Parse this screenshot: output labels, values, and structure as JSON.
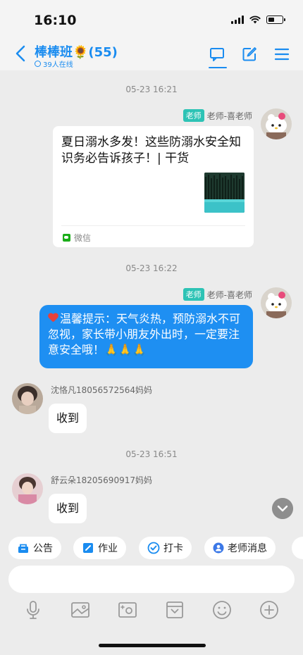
{
  "status_bar": {
    "time": "16:10"
  },
  "header": {
    "title": "棒棒班🌻(55)",
    "online_text": "39人在线"
  },
  "messages": [
    {
      "timestamp": "05-23 16:21"
    },
    {
      "role_badge": "老师",
      "sender": "老师-喜老师",
      "card": {
        "title": "夏日溺水多发！这些防溺水安全知识务必告诉孩子！| 干货",
        "source": "微信"
      }
    },
    {
      "timestamp": "05-23 16:22"
    },
    {
      "role_badge": "老师",
      "sender": "老师-喜老师",
      "text": "温馨提示：天气炎热，预防溺水不可忽视，家长带小朋友外出时，一定要注意安全哦！🙏🙏🙏"
    },
    {
      "sender": "沈恪凡18056572564妈妈",
      "text": "收到"
    },
    {
      "timestamp": "05-23 16:51"
    },
    {
      "sender": "舒云朵18205690917妈妈",
      "text": "收到"
    }
  ],
  "quick_actions": [
    {
      "label": "公告",
      "icon": "notice-icon"
    },
    {
      "label": "作业",
      "icon": "homework-icon"
    },
    {
      "label": "打卡",
      "icon": "checkin-icon"
    },
    {
      "label": "老师消息",
      "icon": "teacher-message-icon"
    }
  ],
  "input": {
    "placeholder": ""
  },
  "toolbar_icons": [
    "microphone-icon",
    "image-icon",
    "video-icon",
    "file-icon",
    "emoji-icon",
    "plus-icon"
  ],
  "colors": {
    "accent": "#1a8cf0",
    "bubble_blue": "#1e8ff2",
    "teacher_badge": "#2dc3b5",
    "background": "#ececec"
  }
}
